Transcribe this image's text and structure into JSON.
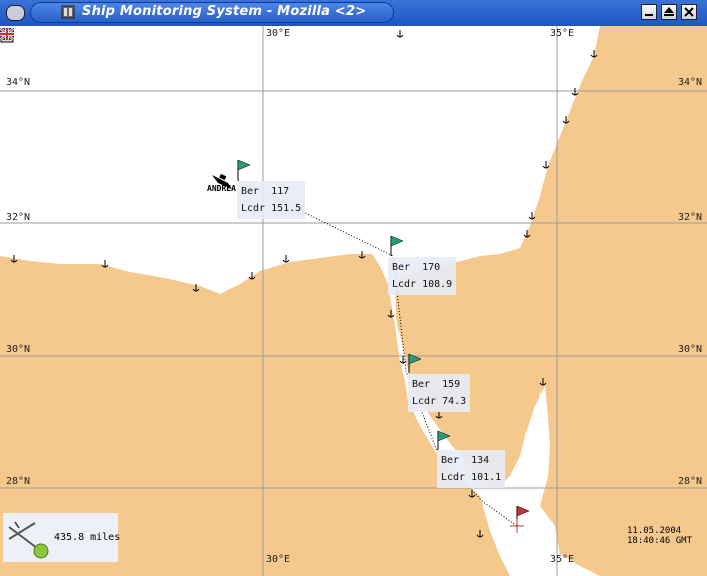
{
  "window": {
    "title": "Ship Monitoring System - Mozilla <2>",
    "buttons": [
      "minimize",
      "maximize",
      "close"
    ]
  },
  "map": {
    "colors": {
      "land": "#f5c98d",
      "sea": "#ffffff",
      "grid": "#9b9b9b",
      "route": "#000000"
    },
    "longitude_labels": [
      "30°E",
      "35°E"
    ],
    "latitude_labels": [
      "34°N",
      "32°N",
      "30°N",
      "28°N"
    ]
  },
  "ship": {
    "name": "ANDREA"
  },
  "waypoints": [
    {
      "ber": "Ber  117",
      "lcdr": "Lcdr 151.5",
      "flag_color": "#2a9a7a"
    },
    {
      "ber": "Ber  170",
      "lcdr": "Lcdr 108.9",
      "flag_color": "#2a9a7a"
    },
    {
      "ber": "Ber  159",
      "lcdr": "Lcdr 74.3",
      "flag_color": "#2a9a7a"
    },
    {
      "ber": "Ber  134",
      "lcdr": "Lcdr 101.1",
      "flag_color": "#2a9a7a"
    },
    {
      "ber": "",
      "lcdr": "",
      "flag_color": "#c9332a"
    }
  ],
  "distance": {
    "value": "435.8 miles",
    "icon": "ruler-compass-icon"
  },
  "datetime": {
    "date": "11.05.2004",
    "time": "18:40:46 GMT"
  },
  "icons": {
    "toolbar": "print-icon",
    "language": "uk-flag-icon"
  }
}
